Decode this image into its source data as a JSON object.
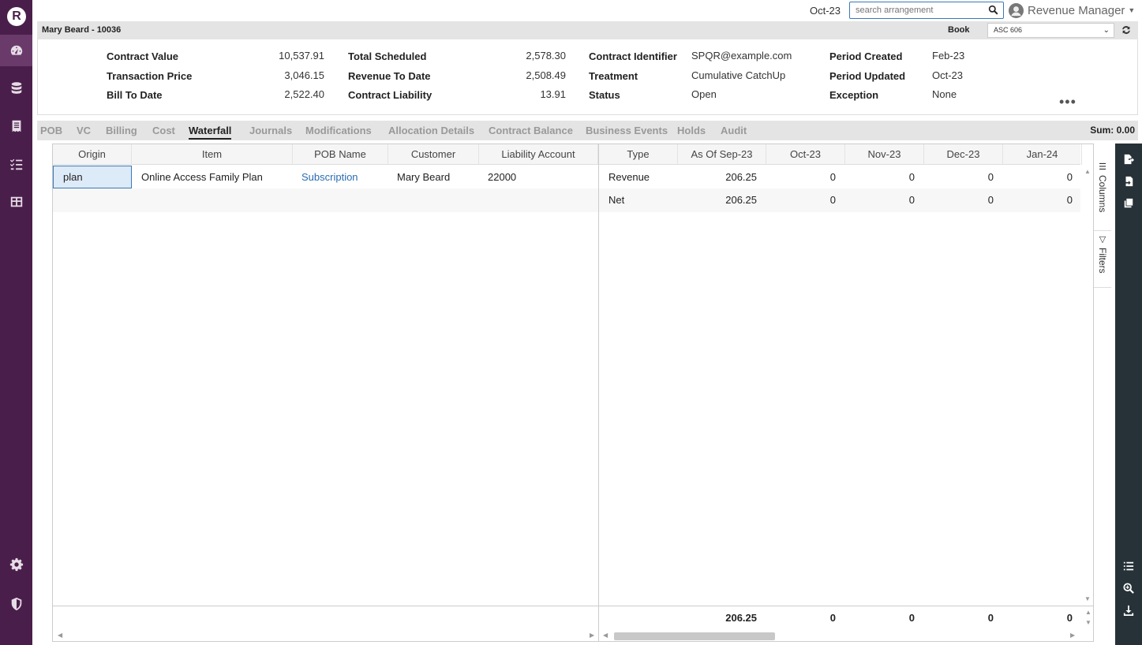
{
  "topbar": {
    "period": "Oct-23",
    "search_placeholder": "search arrangement",
    "user_name": "Revenue Manager"
  },
  "header": {
    "contract_title": "Mary Beard - 10036",
    "book_label": "Book",
    "book_value": "ASC 606"
  },
  "summary": {
    "contract_value_label": "Contract Value",
    "contract_value": "10,537.91",
    "transaction_price_label": "Transaction Price",
    "transaction_price": "3,046.15",
    "bill_to_date_label": "Bill To Date",
    "bill_to_date": "2,522.40",
    "total_scheduled_label": "Total Scheduled",
    "total_scheduled": "2,578.30",
    "revenue_to_date_label": "Revenue To Date",
    "revenue_to_date": "2,508.49",
    "contract_liability_label": "Contract Liability",
    "contract_liability": "13.91",
    "contract_identifier_label": "Contract Identifier",
    "contract_identifier": "SPQR@example.com",
    "treatment_label": "Treatment",
    "treatment": "Cumulative CatchUp",
    "status_label": "Status",
    "status": "Open",
    "period_created_label": "Period Created",
    "period_created": "Feb-23",
    "period_updated_label": "Period Updated",
    "period_updated": "Oct-23",
    "exception_label": "Exception",
    "exception": "None"
  },
  "tabs": [
    "POB",
    "VC",
    "Billing",
    "Cost",
    "Waterfall",
    "Journals",
    "Modifications",
    "Allocation Details",
    "Contract Balance",
    "Business Events",
    "Holds",
    "Audit"
  ],
  "active_tab": "Waterfall",
  "sum_total": "Sum: 0.00",
  "grid": {
    "columns_left": [
      "Origin",
      "Item",
      "POB Name",
      "Customer",
      "Liability Account"
    ],
    "columns_right": [
      "Type",
      "As Of Sep-23",
      "Oct-23",
      "Nov-23",
      "Dec-23",
      "Jan-24"
    ],
    "row": {
      "origin": "plan",
      "item": "Online Access Family Plan",
      "pob_name": "Subscription",
      "customer": "Mary Beard",
      "liability_account": "22000"
    },
    "type_rows": [
      {
        "type": "Revenue",
        "asof": "206.25",
        "oct": "0",
        "nov": "0",
        "dec": "0",
        "jan": "0"
      },
      {
        "type": "Net",
        "asof": "206.25",
        "oct": "0",
        "nov": "0",
        "dec": "0",
        "jan": "0"
      }
    ],
    "footer": {
      "asof": "206.25",
      "oct": "0",
      "nov": "0",
      "dec": "0",
      "jan": "0"
    }
  },
  "side_panel": {
    "columns_label": "Columns",
    "filters_label": "Filters"
  }
}
